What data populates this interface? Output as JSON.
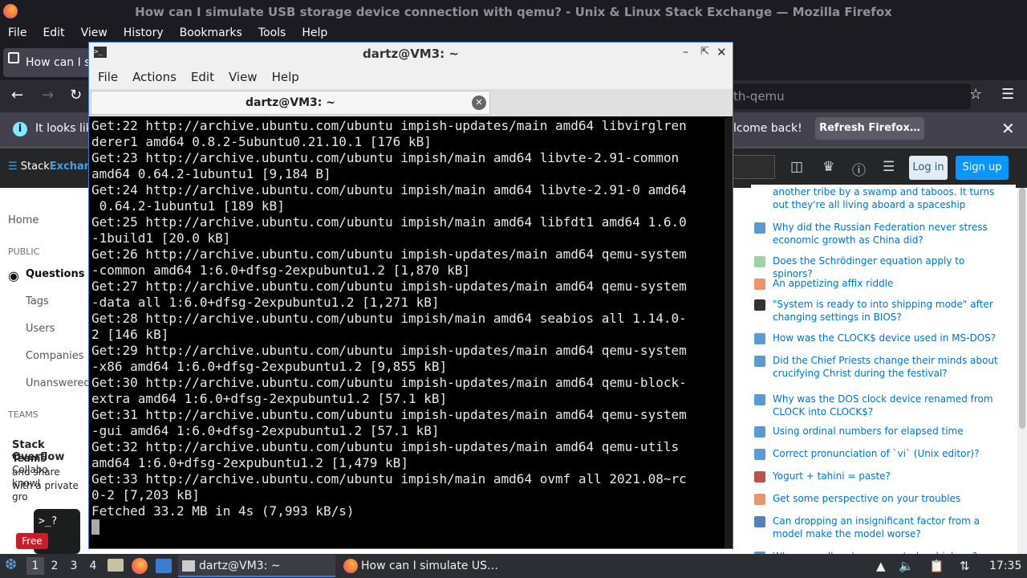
{
  "firefox": {
    "title": "How can I simulate USB storage device connection with qemu? - Unix & Linux Stack Exchange — Mozilla Firefox",
    "menu": [
      "File",
      "Edit",
      "View",
      "History",
      "Bookmarks",
      "Tools",
      "Help"
    ],
    "tab_title": "How can I si",
    "url_fragment": "th-qemu",
    "info_text_start": "It looks lik",
    "info_text_end": "lcome back!",
    "refresh_label": "Refresh Firefox…"
  },
  "stackexchange": {
    "logo_a": "Stack",
    "logo_b": "Exchange",
    "login": "Log in",
    "signup": "Sign up",
    "nav": {
      "home": "Home",
      "public": "PUBLIC",
      "questions": "Questions",
      "tags": "Tags",
      "users": "Users",
      "companies": "Companies",
      "unanswered": "Unanswered",
      "teams": "TEAMS"
    },
    "teams_promo": {
      "title": "Stack Overflow",
      "line1b": "Teams",
      "line1c": " – Collabo",
      "line2": "and share knowl",
      "line3": "with a private gro",
      "badge": "Free"
    },
    "hnq": [
      {
        "text": "another tribe by a swamp and taboos. It turns out they're all living aboard a spaceship",
        "icon_color": "#ffffff"
      },
      {
        "text": "Why did the Russian Federation never stress economic growth as China did?",
        "icon_color": "#5b9bd5"
      },
      {
        "text": "Does the Schrödinger equation apply to spinors?",
        "icon_color": "#9fd3a2"
      },
      {
        "text": "An appetizing affix riddle",
        "icon_color": "#e8956d"
      },
      {
        "text": "\"System is ready to into shipping mode\" after changing settings in BIOS?",
        "icon_color": "#333333"
      },
      {
        "text": "How was the CLOCK$ device used in MS-DOS?",
        "icon_color": "#5b9bd5"
      },
      {
        "text": "Did the Chief Priests change their minds about crucifying Christ during the festival?",
        "icon_color": "#5b9bd5"
      },
      {
        "text": "Why was the DOS clock device renamed from CLOCK into CLOCK$?",
        "icon_color": "#5b9bd5"
      },
      {
        "text": "Using ordinal numbers for elapsed time",
        "icon_color": "#5b9bd5"
      },
      {
        "text": "Correct pronunciation of `vi` (Unix editor)?",
        "icon_color": "#5b9bd5"
      },
      {
        "text": "Yogurt + tahini = paste?",
        "icon_color": "#c0504d"
      },
      {
        "text": "Get some perspective on your troubles",
        "icon_color": "#e8956d"
      },
      {
        "text": "Can dropping an insignificant factor from a model make the model worse?",
        "icon_color": "#4f81bd"
      },
      {
        "text": "Why are pull up bars mounted so high up?",
        "icon_color": "#5b9bd5"
      }
    ]
  },
  "terminal": {
    "title": "dartz@VM3: ~",
    "tab_title": "dartz@VM3: ~",
    "menu": [
      "File",
      "Actions",
      "Edit",
      "View",
      "Help"
    ],
    "lines": [
      "Get:22 http://archive.ubuntu.com/ubuntu impish-updates/main amd64 libvirglren",
      "derer1 amd64 0.8.2-5ubuntu0.21.10.1 [176 kB]",
      "Get:23 http://archive.ubuntu.com/ubuntu impish/main amd64 libvte-2.91-common",
      "amd64 0.64.2-1ubuntu1 [9,184 B]",
      "Get:24 http://archive.ubuntu.com/ubuntu impish/main amd64 libvte-2.91-0 amd64",
      " 0.64.2-1ubuntu1 [189 kB]",
      "Get:25 http://archive.ubuntu.com/ubuntu impish/main amd64 libfdt1 amd64 1.6.0",
      "-1build1 [20.0 kB]",
      "Get:26 http://archive.ubuntu.com/ubuntu impish-updates/main amd64 qemu-system",
      "-common amd64 1:6.0+dfsg-2expubuntu1.2 [1,870 kB]",
      "Get:27 http://archive.ubuntu.com/ubuntu impish-updates/main amd64 qemu-system",
      "-data all 1:6.0+dfsg-2expubuntu1.2 [1,271 kB]",
      "Get:28 http://archive.ubuntu.com/ubuntu impish/main amd64 seabios all 1.14.0-",
      "2 [146 kB]",
      "Get:29 http://archive.ubuntu.com/ubuntu impish-updates/main amd64 qemu-system",
      "-x86 amd64 1:6.0+dfsg-2expubuntu1.2 [9,855 kB]",
      "Get:30 http://archive.ubuntu.com/ubuntu impish-updates/main amd64 qemu-block-",
      "extra amd64 1:6.0+dfsg-2expubuntu1.2 [57.1 kB]",
      "Get:31 http://archive.ubuntu.com/ubuntu impish-updates/main amd64 qemu-system",
      "-gui amd64 1:6.0+dfsg-2expubuntu1.2 [57.1 kB]",
      "Get:32 http://archive.ubuntu.com/ubuntu impish-updates/main amd64 qemu-utils",
      "amd64 1:6.0+dfsg-2expubuntu1.2 [1,479 kB]",
      "Get:33 http://archive.ubuntu.com/ubuntu impish/main amd64 ovmf all 2021.08~rc",
      "0-2 [7,203 kB]",
      "Fetched 33.2 MB in 4s (7,993 kB/s)"
    ]
  },
  "taskbar": {
    "workspaces": [
      "1",
      "2",
      "3",
      "4"
    ],
    "term_task": "dartz@VM3: ~",
    "ff_task": "How can I simulate US…",
    "clock": "17:35"
  }
}
